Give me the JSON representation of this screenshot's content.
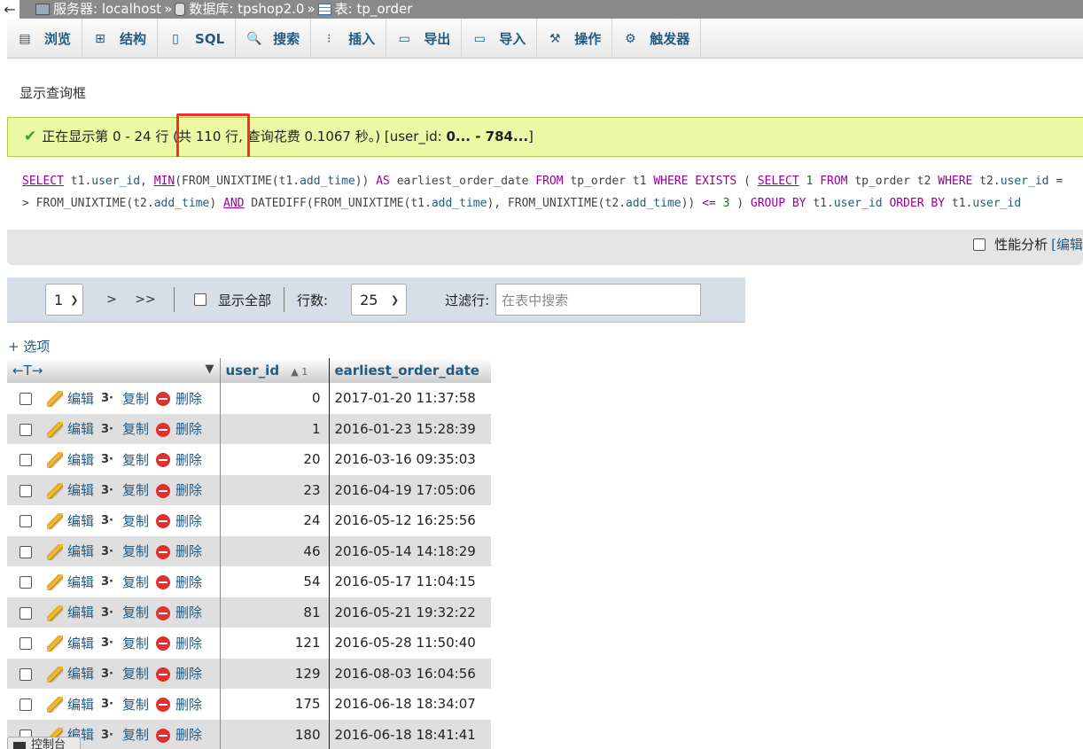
{
  "breadcrumb": {
    "back": "←",
    "server": "服务器: localhost",
    "database": "数据库: tpshop2.0",
    "table": "表: tp_order",
    "sep": "»"
  },
  "tabs": [
    {
      "name": "tab-browse",
      "icon": "browse-icon",
      "glyph": "▤",
      "label": "浏览"
    },
    {
      "name": "tab-structure",
      "icon": "structure-icon",
      "glyph": "⊞",
      "label": "结构"
    },
    {
      "name": "tab-sql",
      "icon": "sql-icon",
      "glyph": "▯",
      "label": "SQL"
    },
    {
      "name": "tab-search",
      "icon": "search-icon",
      "glyph": "🔍",
      "label": "搜索"
    },
    {
      "name": "tab-insert",
      "icon": "insert-icon",
      "glyph": "⁝",
      "label": "插入"
    },
    {
      "name": "tab-export",
      "icon": "export-icon",
      "glyph": "▭",
      "label": "导出"
    },
    {
      "name": "tab-import",
      "icon": "import-icon",
      "glyph": "▭",
      "label": "导入"
    },
    {
      "name": "tab-operations",
      "icon": "wrench-icon",
      "glyph": "⚒",
      "label": "操作"
    },
    {
      "name": "tab-triggers",
      "icon": "trigger-icon",
      "glyph": "⚙",
      "label": "触发器"
    }
  ],
  "query_box_link": "显示查询框",
  "success": {
    "prefix": "正在显示第 0 - 24 行 ",
    "count": "(共 110 行,",
    "suffix": " 查询花费 0.1067 秒。) [user_id: ",
    "range": "0... - 784...",
    "close": "]"
  },
  "sql": {
    "line1": [
      {
        "t": "SELECT",
        "c": "kwu"
      },
      {
        "t": " t1.",
        "c": ""
      },
      {
        "t": "user_id",
        "c": "fn"
      },
      {
        "t": ", ",
        "c": ""
      },
      {
        "t": "MIN",
        "c": "kwu"
      },
      {
        "t": "(FROM_UNIXTIME(t1.",
        "c": ""
      },
      {
        "t": "add_time",
        "c": "fn"
      },
      {
        "t": ")) ",
        "c": ""
      },
      {
        "t": "AS",
        "c": "kw"
      },
      {
        "t": " earliest_order_date ",
        "c": ""
      },
      {
        "t": "FROM",
        "c": "kw"
      },
      {
        "t": " tp_order t1 ",
        "c": ""
      },
      {
        "t": "WHERE",
        "c": "kw"
      },
      {
        "t": " ",
        "c": ""
      },
      {
        "t": "EXISTS",
        "c": "kw"
      },
      {
        "t": " ( ",
        "c": ""
      },
      {
        "t": "SELECT",
        "c": "kwu"
      },
      {
        "t": " ",
        "c": ""
      },
      {
        "t": "1",
        "c": "num"
      },
      {
        "t": " ",
        "c": ""
      },
      {
        "t": "FROM",
        "c": "kw"
      },
      {
        "t": " tp_order t2 ",
        "c": ""
      },
      {
        "t": "WHERE",
        "c": "kw"
      },
      {
        "t": " t2.",
        "c": ""
      },
      {
        "t": "user_id",
        "c": "fn"
      },
      {
        "t": " =",
        "c": ""
      }
    ],
    "line2": [
      {
        "t": "> FROM_UNIXTIME(t2.",
        "c": ""
      },
      {
        "t": "add_time",
        "c": "fn"
      },
      {
        "t": ") ",
        "c": ""
      },
      {
        "t": "AND",
        "c": "kwu"
      },
      {
        "t": " DATEDIFF(FROM_UNIXTIME(t1.",
        "c": ""
      },
      {
        "t": "add_time",
        "c": "fn"
      },
      {
        "t": "), FROM_UNIXTIME(t2.",
        "c": ""
      },
      {
        "t": "add_time",
        "c": "fn"
      },
      {
        "t": ")) ",
        "c": ""
      },
      {
        "t": "<=",
        "c": "kw"
      },
      {
        "t": " ",
        "c": ""
      },
      {
        "t": "3",
        "c": "num"
      },
      {
        "t": " ) ",
        "c": ""
      },
      {
        "t": "GROUP BY",
        "c": "kw"
      },
      {
        "t": " t1.",
        "c": ""
      },
      {
        "t": "user_id",
        "c": "fn"
      },
      {
        "t": " ",
        "c": ""
      },
      {
        "t": "ORDER BY",
        "c": "kw"
      },
      {
        "t": " t1.",
        "c": ""
      },
      {
        "t": "user_id",
        "c": "fn"
      }
    ]
  },
  "profiling": {
    "label": "性能分析",
    "link": "[编辑"
  },
  "nav": {
    "page": "1",
    "next": ">",
    "last": ">>",
    "show_all": "显示全部",
    "rows_label": "行数:",
    "rows_value": "25",
    "filter_label": "过滤行:",
    "filter_placeholder": "在表中搜索"
  },
  "options_link": "+ 选项",
  "columns": {
    "arrows": "←T→",
    "sort_toggle": "▼",
    "user_id": "user_id",
    "sort_indicator": "▲ 1",
    "earliest": "earliest_order_date"
  },
  "actions": {
    "edit": "编辑",
    "copy": "复制",
    "delete": "删除",
    "copy_glyph": "3·"
  },
  "rows": [
    {
      "user_id": "0",
      "date": "2017-01-20 11:37:58"
    },
    {
      "user_id": "1",
      "date": "2016-01-23 15:28:39"
    },
    {
      "user_id": "20",
      "date": "2016-03-16 09:35:03"
    },
    {
      "user_id": "23",
      "date": "2016-04-19 17:05:06"
    },
    {
      "user_id": "24",
      "date": "2016-05-12 16:25:56"
    },
    {
      "user_id": "46",
      "date": "2016-05-14 14:18:29"
    },
    {
      "user_id": "54",
      "date": "2016-05-17 11:04:15"
    },
    {
      "user_id": "81",
      "date": "2016-05-21 19:32:22"
    },
    {
      "user_id": "121",
      "date": "2016-05-28 11:50:40"
    },
    {
      "user_id": "129",
      "date": "2016-08-03 16:04:56"
    },
    {
      "user_id": "175",
      "date": "2016-06-18 18:34:07"
    },
    {
      "user_id": "180",
      "date": "2016-06-18 18:41:41"
    }
  ],
  "console": "控制台",
  "colors": {
    "accent": "#235a81",
    "success_bg": "#ebf8a4",
    "highlight": "#ff2a2a"
  }
}
